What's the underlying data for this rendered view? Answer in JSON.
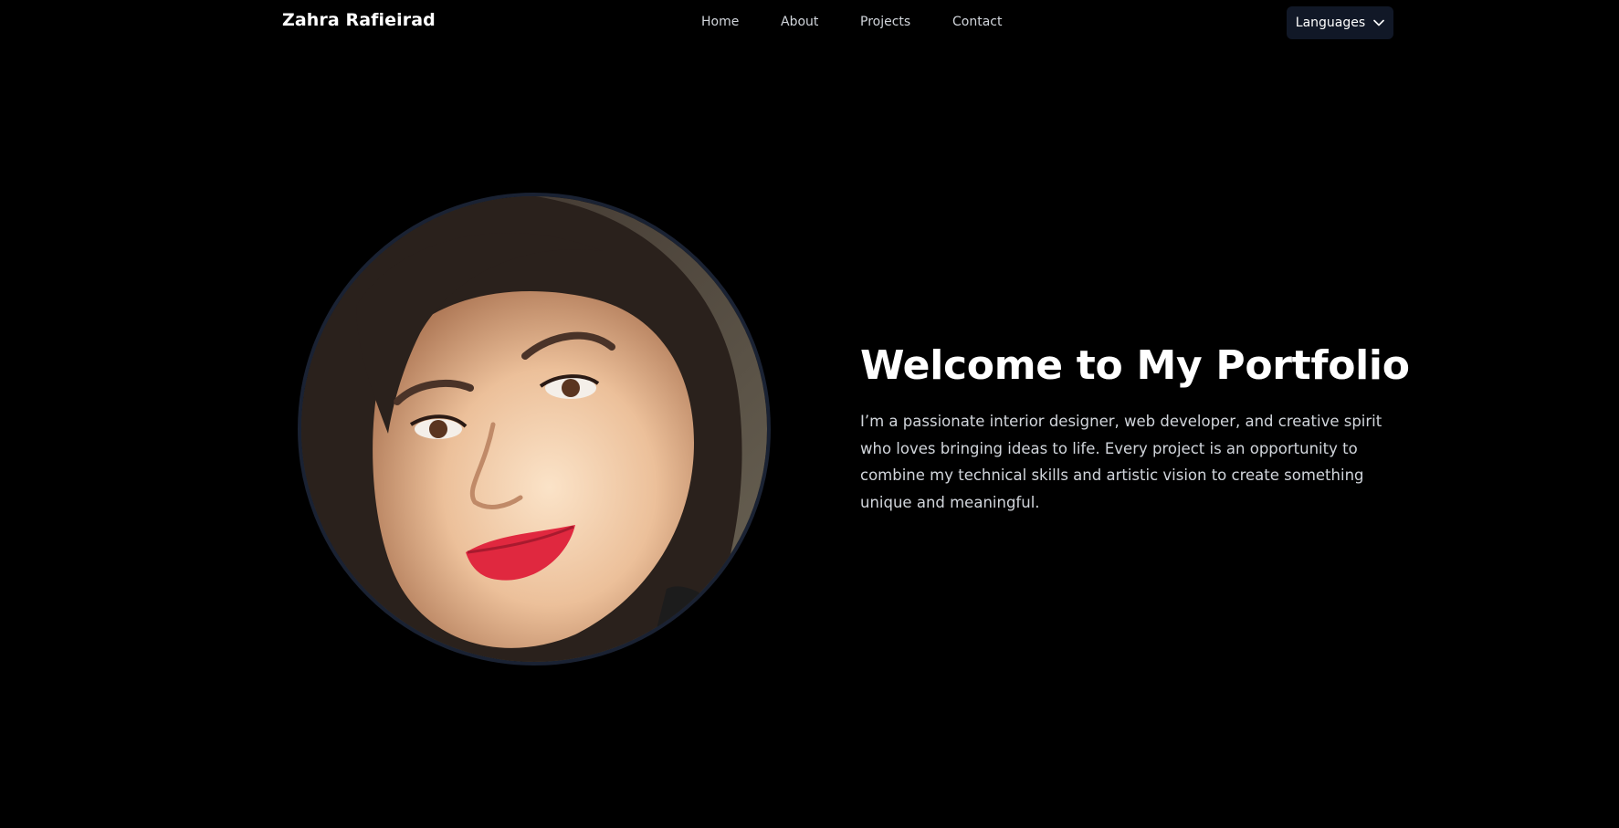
{
  "header": {
    "brand": "Zahra Rafieirad",
    "nav": [
      {
        "label": "Home"
      },
      {
        "label": "About"
      },
      {
        "label": "Projects"
      },
      {
        "label": "Contact"
      }
    ],
    "language_button": {
      "label": "Languages",
      "icon": "chevron-down-icon"
    }
  },
  "hero": {
    "title": "Welcome to My Portfolio",
    "description": "I’m a passionate interior designer, web developer, and creative spirit who loves bringing ideas to life. Every project is an opportunity to combine my technical skills and artistic vision to create something unique and meaningful."
  },
  "colors": {
    "background": "#000000",
    "text_primary": "#ffffff",
    "text_secondary": "#d1d5db",
    "button_background": "#111827",
    "portrait_border": "#1a2233"
  }
}
